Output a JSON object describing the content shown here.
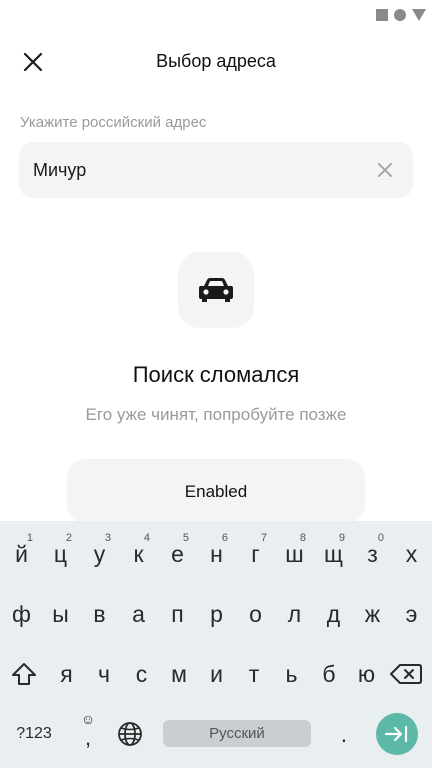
{
  "status_bar": {
    "icons": [
      "square-icon",
      "circle-icon",
      "triangle-icon"
    ]
  },
  "header": {
    "title": "Выбор адреса",
    "close_icon": "close-icon"
  },
  "address": {
    "label": "Укажите российский адрес",
    "value": "Мичур",
    "clear_icon": "clear-icon"
  },
  "empty_state": {
    "icon": "car-icon",
    "title": "Поиск сломался",
    "subtitle": "Его уже чинят, попробуйте позже"
  },
  "action_button": {
    "label": "Enabled"
  },
  "keyboard": {
    "row1": [
      {
        "label": "й",
        "hint": "1"
      },
      {
        "label": "ц",
        "hint": "2"
      },
      {
        "label": "у",
        "hint": "3"
      },
      {
        "label": "к",
        "hint": "4"
      },
      {
        "label": "е",
        "hint": "5"
      },
      {
        "label": "н",
        "hint": "6"
      },
      {
        "label": "г",
        "hint": "7"
      },
      {
        "label": "ш",
        "hint": "8"
      },
      {
        "label": "щ",
        "hint": "9"
      },
      {
        "label": "з",
        "hint": "0"
      },
      {
        "label": "х",
        "hint": ""
      }
    ],
    "row2": [
      "ф",
      "ы",
      "в",
      "а",
      "п",
      "р",
      "о",
      "л",
      "д",
      "ж",
      "э"
    ],
    "row3": [
      "я",
      "ч",
      "с",
      "м",
      "и",
      "т",
      "ь",
      "б",
      "ю"
    ],
    "symbols_label": "?123",
    "comma_label": ",",
    "space_label": "Русский",
    "period_label": ".",
    "accent_color": "#5cb8a7"
  }
}
